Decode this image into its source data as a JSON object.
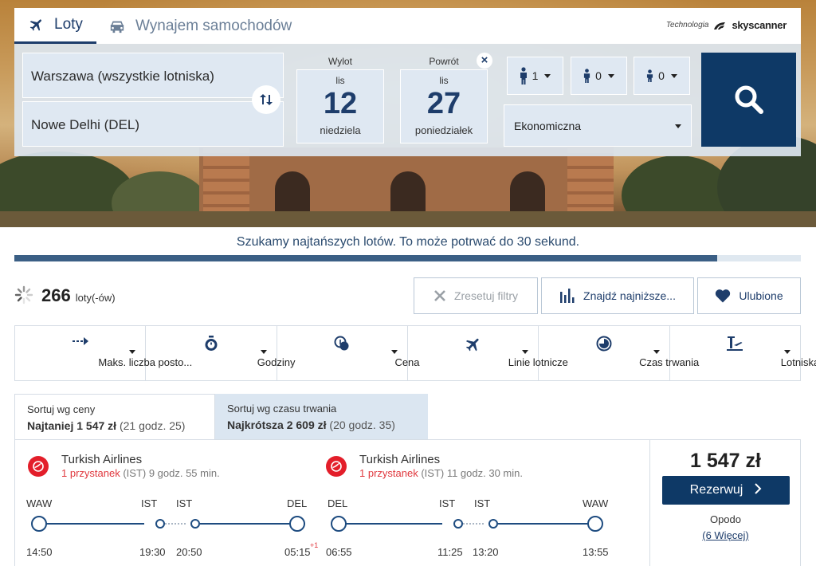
{
  "tabs": {
    "flights": "Loty",
    "cars": "Wynajem samochodów"
  },
  "powered": {
    "label": "Technologia",
    "brand": "skyscanner"
  },
  "search": {
    "from": "Warszawa (wszystkie lotniska)",
    "to": "Nowe Delhi (DEL)",
    "depart": {
      "label": "Wylot",
      "month": "lis",
      "day": "12",
      "weekday": "niedziela"
    },
    "return": {
      "label": "Powrót",
      "month": "lis",
      "day": "27",
      "weekday": "poniedziałek"
    },
    "close_label": "×",
    "adults": "1",
    "children": "0",
    "infants": "0",
    "cabin": "Ekonomiczna"
  },
  "progress": {
    "text": "Szukamy najtańszych lotów. To może potrwać do 30 sekund.",
    "fraction": 0.894
  },
  "results": {
    "count": "266",
    "count_unit": "loty(-ów)",
    "reset_label": "Zresetuj filtry",
    "find_label": "Znajdź najniższe...",
    "fav_label": "Ulubione"
  },
  "filters": [
    {
      "label": "Maks. liczba posto...",
      "icon": "stops-icon"
    },
    {
      "label": "Godziny",
      "icon": "stopwatch-icon"
    },
    {
      "label": "Cena",
      "icon": "coins-icon"
    },
    {
      "label": "Linie lotnicze",
      "icon": "plane-icon"
    },
    {
      "label": "Czas trwania",
      "icon": "clock-icon"
    },
    {
      "label": "Lotniska",
      "icon": "airport-icon"
    }
  ],
  "sort": {
    "price": {
      "title": "Sortuj wg ceny",
      "prefix": "Najtaniej",
      "value": "1 547 zł",
      "detail": "(21 godz. 25)"
    },
    "duration": {
      "title": "Sortuj wg czasu trwania",
      "prefix": "Najkrótsza",
      "value": "2 609 zł",
      "detail": "(20 godz. 35)"
    }
  },
  "card": {
    "price": "1 547 zł",
    "book_label": "Rezerwuj",
    "agent": "Opodo",
    "more": "(6 Więcej)",
    "outbound": {
      "airline": "Turkish Airlines",
      "stops": "1 przystanek",
      "stop_detail": "(IST) 9 godz. 55 min.",
      "codes": [
        "WAW",
        "IST",
        "IST",
        "DEL"
      ],
      "times": [
        "14:50",
        "19:30",
        "20:50",
        "05:15"
      ],
      "plus_day": "+1"
    },
    "inbound": {
      "airline": "Turkish Airlines",
      "stops": "1 przystanek",
      "stop_detail": "(IST) 11 godz. 30 min.",
      "codes": [
        "DEL",
        "IST",
        "IST",
        "WAW"
      ],
      "times": [
        "06:55",
        "11:25",
        "13:20",
        "13:55"
      ]
    }
  },
  "colors": {
    "brand": "#0e3966",
    "accent": "#1e4c80",
    "stop_red": "#e0383e",
    "airline_red": "#e31e2a"
  }
}
